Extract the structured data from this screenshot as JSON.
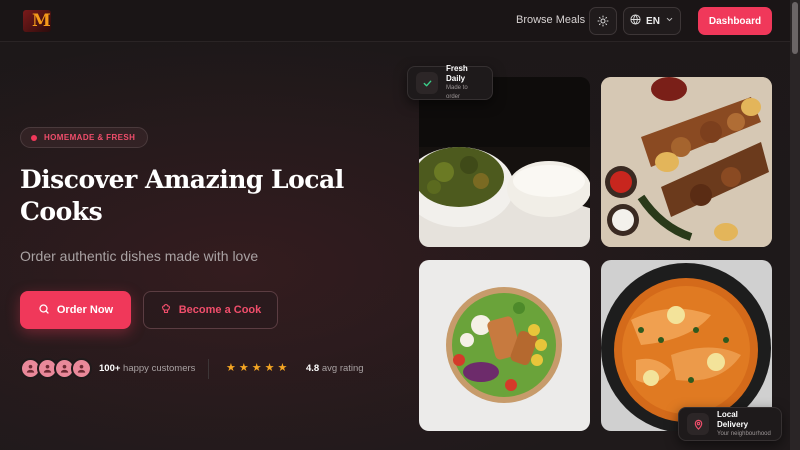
{
  "header": {
    "logo_letter": "M",
    "nav_link": "Browse Meals",
    "language": "EN",
    "dashboard_label": "Dashboard"
  },
  "hero": {
    "badge": "HOMEMADE & FRESH",
    "title": "Discover Amazing Local Cooks",
    "subtitle": "Order authentic dishes made with love",
    "order_label": "Order Now",
    "cook_label": "Become a Cook",
    "customers_count": "100+",
    "customers_text": "happy customers",
    "rating_value": "4.8",
    "rating_text": "avg rating",
    "star_count": 5
  },
  "cards": {
    "fresh_title": "Fresh Daily",
    "fresh_sub": "Made to order",
    "delivery_title": "Local Delivery",
    "delivery_sub": "Your neighbourhood"
  },
  "colors": {
    "accent": "#f0385a",
    "star": "#f5a623",
    "background": "#1c1717"
  },
  "icons": [
    "sun-icon",
    "globe-icon",
    "chevron-down-icon",
    "search-icon",
    "chef-hat-icon",
    "user-icon",
    "star-icon",
    "check-icon",
    "location-pin-icon"
  ]
}
